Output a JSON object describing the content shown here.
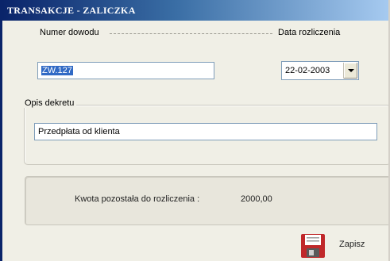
{
  "window": {
    "title": "TRANSAKCJE - ZALICZKA"
  },
  "document_number": {
    "label": "Numer dowodu",
    "value": "ZW.127"
  },
  "settlement_date": {
    "label": "Data rozliczenia",
    "value": "22-02-2003"
  },
  "entry_description": {
    "label": "Opis dekretu",
    "value": "Przedpłata od klienta"
  },
  "remaining": {
    "label": "Kwota pozostała do rozliczenia :",
    "amount": "2000,00"
  },
  "actions": {
    "save_label": "Zapisz"
  },
  "colors": {
    "title_bar_start": "#0a246a",
    "selection": "#316ac5",
    "save_icon_red": "#c0282a"
  },
  "icons": [
    "floppy-disk-icon",
    "chevron-down-icon"
  ]
}
